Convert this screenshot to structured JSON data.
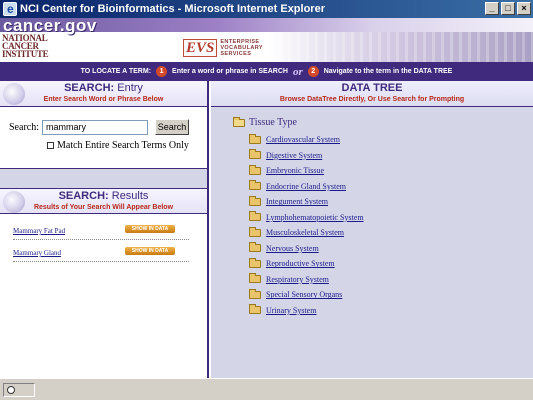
{
  "window": {
    "title": "NCI Center for Bioinformatics - Microsoft Internet Explorer",
    "minimize": "_",
    "maximize": "□",
    "close": "×"
  },
  "banner": {
    "cancer_gov": "cancer.gov",
    "nci_line1": "NATIONAL",
    "nci_line2": "CANCER",
    "nci_line3": "INSTITUTE",
    "evs_mark": "EVS",
    "evs_line1": "ENTERPRISE",
    "evs_line2": "VOCABULARY",
    "evs_line3": "SERVICES"
  },
  "locate": {
    "prefix": "TO LOCATE A TERM:",
    "step1_num": "1",
    "step1_text": "Enter a word or phrase in SEARCH",
    "or": "or",
    "step2_num": "2",
    "step2_text": "Navigate to the term in the DATA TREE"
  },
  "search_entry": {
    "title_bold": "SEARCH:",
    "title_light": "Entry",
    "subtitle": "Enter Search Word or Phrase Below",
    "label": "Search:",
    "value": "mammary",
    "button": "Search",
    "match_label": "Match Entire Search Terms Only",
    "match_checked": false
  },
  "search_results": {
    "title_bold": "SEARCH:",
    "title_light": "Results",
    "subtitle": "Results of Your Search Will Appear Below",
    "show_label": "SHOW IN DATA TREE",
    "items": [
      {
        "label": "Mammary Fat Pad"
      },
      {
        "label": "Mammary Gland"
      }
    ]
  },
  "data_tree": {
    "title": "DATA TREE",
    "subtitle": "Browse DataTree Directly, Or Use Search for Prompting",
    "root": "Tissue Type",
    "items": [
      "Cardiovascular System",
      "Digestive System",
      "Embryonic Tissue",
      "Endocrine Gland System",
      "Integument System",
      "Lymphohematopoietic System",
      "Musculoskeletal System",
      "Nervous System",
      "Reproductive System",
      "Respiratory System",
      "Special Sensory Organs",
      "Urinary System"
    ]
  },
  "colors": {
    "brand_purple": "#3f2a7e",
    "accent_red": "#b7271a",
    "tree_bg": "#d4d6e8"
  }
}
